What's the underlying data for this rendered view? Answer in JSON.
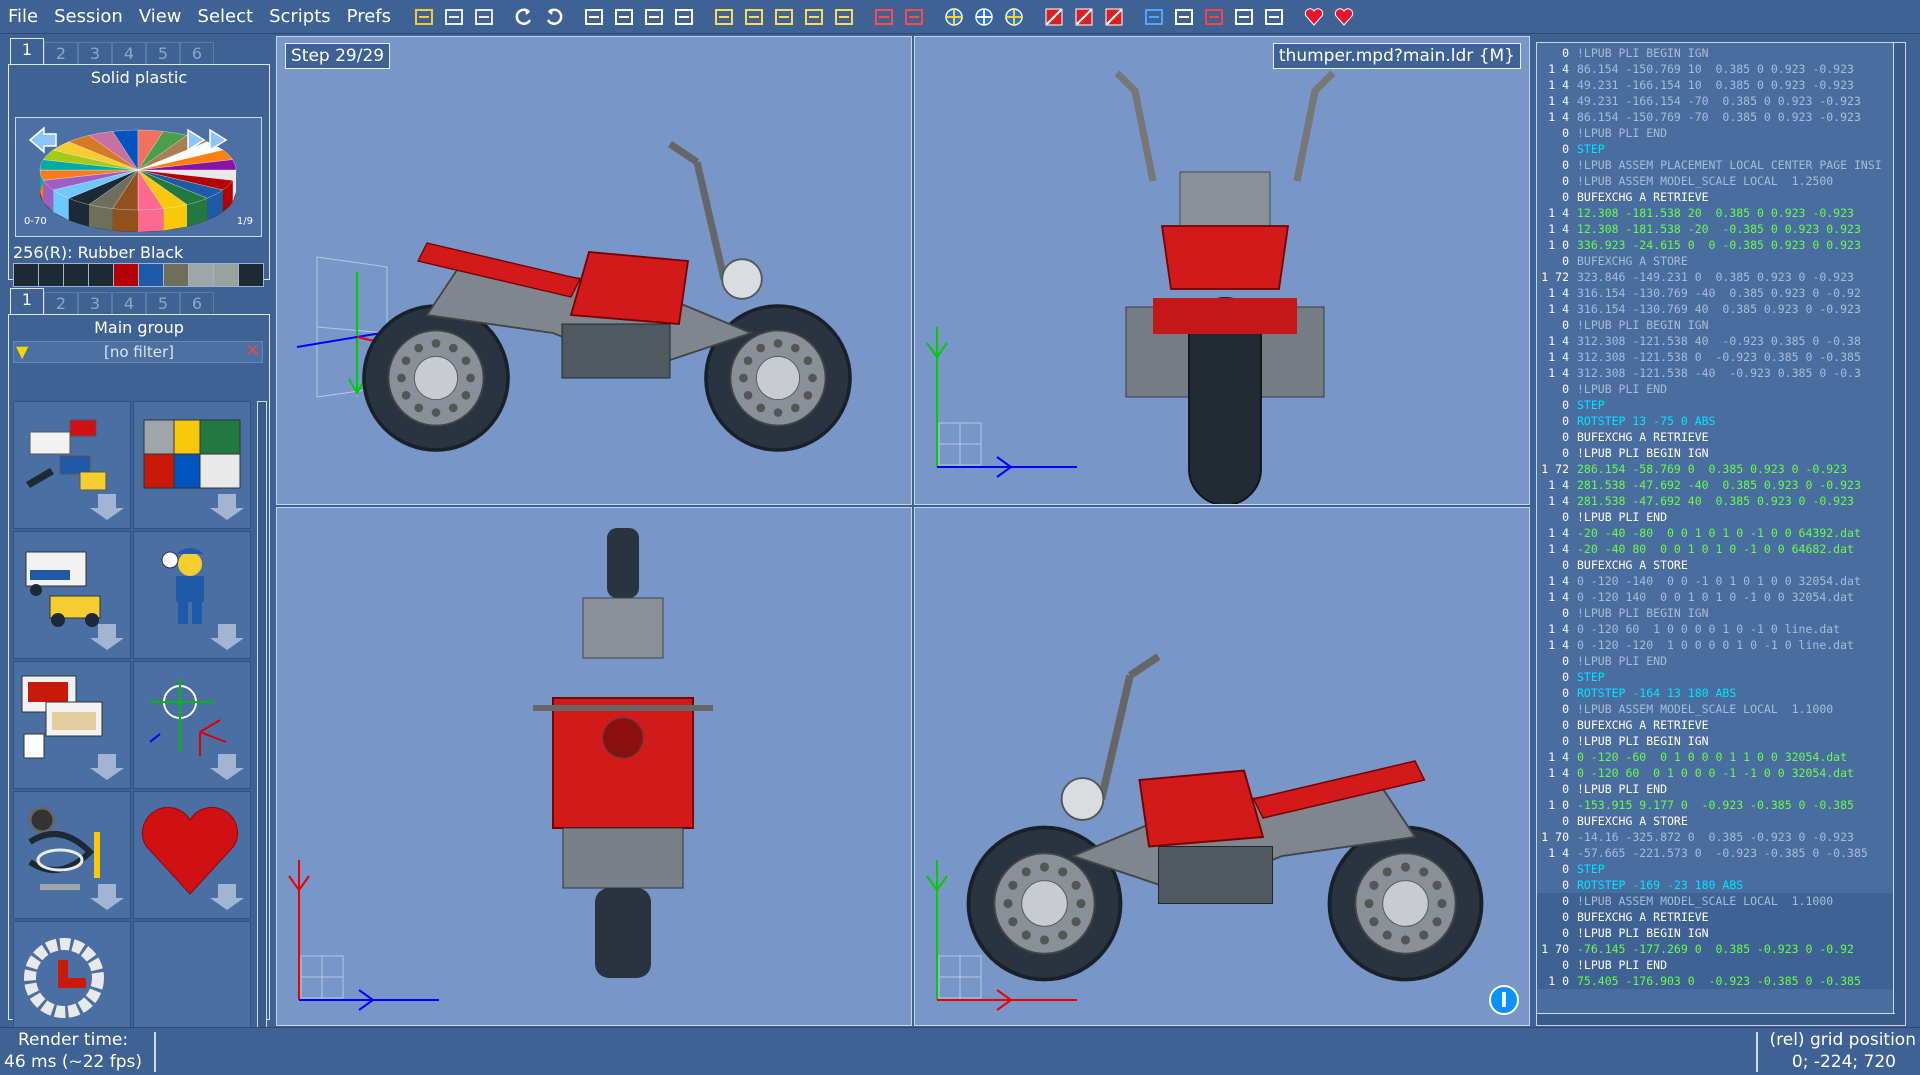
{
  "menu": [
    "File",
    "Session",
    "View",
    "Select",
    "Scripts",
    "Prefs"
  ],
  "toolbar_icons": [
    "open-icon",
    "save-icon",
    "save-as-icon",
    "undo-icon",
    "redo-icon",
    "copy-icon",
    "cut-icon",
    "paste-icon",
    "select-all-icon",
    "first-step-icon",
    "prev-step-icon",
    "next-step-icon",
    "last-step-icon",
    "add-step-icon",
    "insert-part-icon",
    "move-part-icon",
    "color-wheel-icon",
    "crosshair-icon",
    "render-icon",
    "delete-icon",
    "delete-step-icon",
    "clear-icon",
    "grid-icon",
    "move-icon",
    "rotate-icon",
    "pan-icon",
    "snap-icon",
    "favorite-icon",
    "favorite-add-icon"
  ],
  "colors": {
    "bg": "#3e6294",
    "view_bg": "#7896c8",
    "code_bg": "#4a6da0",
    "keyword": "#00e5ff",
    "number": "#67ff45",
    "white": "#ffffff",
    "muted": "#a9bcd6"
  },
  "color_panel": {
    "tabs": [
      "1",
      "2",
      "3",
      "4",
      "5",
      "6"
    ],
    "title": "Solid plastic",
    "range_left": "0-70",
    "range_right": "1/9",
    "selected": "256(R): Rubber Black"
  },
  "swatches": [
    "#1b2a34",
    "#1b2a34",
    "#1b2a34",
    "#1b2a34",
    "#b40000",
    "#1e5aa8",
    "#6d6e5c",
    "#a0a5a9",
    "#9ba19d",
    "#1b2a34"
  ],
  "parts_panel": {
    "tabs": [
      "1",
      "2",
      "3",
      "4",
      "5",
      "6"
    ],
    "title": "Main group",
    "filter": "[no filter]",
    "bins": [
      "bricks-bin-icon",
      "colored-bricks-bin-icon",
      "vehicles-bin-icon",
      "minifig-bin-icon",
      "mpd-bin-icon",
      "axes-bin-icon",
      "cables-bin-icon",
      "heart-bin-icon",
      "ring-bin-icon"
    ]
  },
  "views": {
    "step_label": "Step 29/29",
    "file_label": "thumper.mpd?main.ldr {M}"
  },
  "code_lines": [
    {
      "p": "0",
      "t": "!LPUB PLI BEGIN IGN",
      "c": "muted"
    },
    {
      "p": "1 4",
      "t": "86.154 -150.769 10  0.385 0 0.923 -0.923",
      "c": "muted"
    },
    {
      "p": "1 4",
      "t": "49.231 -166.154 10  0.385 0 0.923 -0.923",
      "c": "muted"
    },
    {
      "p": "1 4",
      "t": "49.231 -166.154 -70  0.385 0 0.923 -0.923",
      "c": "muted"
    },
    {
      "p": "1 4",
      "t": "86.154 -150.769 -70  0.385 0 0.923 -0.923",
      "c": "muted"
    },
    {
      "p": "0",
      "t": "!LPUB PLI END",
      "c": "muted"
    },
    {
      "p": "0",
      "t": "STEP",
      "c": "keyword"
    },
    {
      "p": "0",
      "t": "!LPUB ASSEM PLACEMENT LOCAL CENTER PAGE INSI",
      "c": "muted"
    },
    {
      "p": "0",
      "t": "!LPUB ASSEM MODEL_SCALE LOCAL  1.2500",
      "c": "muted"
    },
    {
      "p": "0",
      "t": "BUFEXCHG A RETRIEVE",
      "c": "white"
    },
    {
      "p": "1 4",
      "t": "12.308 -181.538 20  0.385 0 0.923 -0.923",
      "c": "number"
    },
    {
      "p": "1 4",
      "t": "12.308 -181.538 -20  -0.385 0 0.923 0.923",
      "c": "number"
    },
    {
      "p": "1 0",
      "t": "336.923 -24.615 0  0 -0.385 0.923 0 0.923",
      "c": "number"
    },
    {
      "p": "0",
      "t": "BUFEXCHG A STORE",
      "c": "muted"
    },
    {
      "p": "1 72",
      "t": "323.846 -149.231 0  0.385 0.923 0 -0.923",
      "c": "muted"
    },
    {
      "p": "1 4",
      "t": "316.154 -130.769 -40  0.385 0.923 0 -0.92",
      "c": "muted"
    },
    {
      "p": "1 4",
      "t": "316.154 -130.769 40  0.385 0.923 0 -0.923",
      "c": "muted"
    },
    {
      "p": "0",
      "t": "!LPUB PLI BEGIN IGN",
      "c": "muted"
    },
    {
      "p": "1 4",
      "t": "312.308 -121.538 40  -0.923 0.385 0 -0.38",
      "c": "muted"
    },
    {
      "p": "1 4",
      "t": "312.308 -121.538 0  -0.923 0.385 0 -0.385",
      "c": "muted"
    },
    {
      "p": "1 4",
      "t": "312.308 -121.538 -40  -0.923 0.385 0 -0.3",
      "c": "muted"
    },
    {
      "p": "0",
      "t": "!LPUB PLI END",
      "c": "muted"
    },
    {
      "p": "0",
      "t": "STEP",
      "c": "keyword"
    },
    {
      "p": "0",
      "t": "ROTSTEP 13 -75 0 ABS",
      "c": "keyword"
    },
    {
      "p": "0",
      "t": "BUFEXCHG A RETRIEVE",
      "c": "white"
    },
    {
      "p": "0",
      "t": "!LPUB PLI BEGIN IGN",
      "c": "white"
    },
    {
      "p": "1 72",
      "t": "286.154 -58.769 0  0.385 0.923 0 -0.923",
      "c": "number"
    },
    {
      "p": "1 4",
      "t": "281.538 -47.692 -40  0.385 0.923 0 -0.923",
      "c": "number"
    },
    {
      "p": "1 4",
      "t": "281.538 -47.692 40  0.385 0.923 0 -0.923",
      "c": "number"
    },
    {
      "p": "0",
      "t": "!LPUB PLI END",
      "c": "white"
    },
    {
      "p": "1 4",
      "t": "-20 -40 -80  0 0 1 0 1 0 -1 0 0 64392.dat",
      "c": "number"
    },
    {
      "p": "1 4",
      "t": "-20 -40 80  0 0 1 0 1 0 -1 0 0 64682.dat",
      "c": "number"
    },
    {
      "p": "0",
      "t": "BUFEXCHG A STORE",
      "c": "white"
    },
    {
      "p": "1 4",
      "t": "0 -120 -140  0 0 -1 0 1 0 1 0 0 32054.dat",
      "c": "muted"
    },
    {
      "p": "1 4",
      "t": "0 -120 140  0 0 1 0 1 0 -1 0 0 32054.dat",
      "c": "muted"
    },
    {
      "p": "0",
      "t": "!LPUB PLI BEGIN IGN",
      "c": "muted"
    },
    {
      "p": "1 4",
      "t": "0 -120 60  1 0 0 0 0 1 0 -1 0 line.dat",
      "c": "muted"
    },
    {
      "p": "1 4",
      "t": "0 -120 -120  1 0 0 0 0 1 0 -1 0 line.dat",
      "c": "muted"
    },
    {
      "p": "0",
      "t": "!LPUB PLI END",
      "c": "muted"
    },
    {
      "p": "0",
      "t": "STEP",
      "c": "keyword"
    },
    {
      "p": "0",
      "t": "ROTSTEP -164 13 180 ABS",
      "c": "keyword"
    },
    {
      "p": "0",
      "t": "!LPUB ASSEM MODEL_SCALE LOCAL  1.1000",
      "c": "muted"
    },
    {
      "p": "0",
      "t": "BUFEXCHG A RETRIEVE",
      "c": "white"
    },
    {
      "p": "0",
      "t": "!LPUB PLI BEGIN IGN",
      "c": "white"
    },
    {
      "p": "1 4",
      "t": "0 -120 -60  0 1 0 0 0 1 1 0 0 32054.dat",
      "c": "number"
    },
    {
      "p": "1 4",
      "t": "0 -120 60  0 1 0 0 0 -1 -1 0 0 32054.dat",
      "c": "number"
    },
    {
      "p": "0",
      "t": "!LPUB PLI END",
      "c": "white"
    },
    {
      "p": "1 0",
      "t": "-153.915 9.177 0  -0.923 -0.385 0 -0.385",
      "c": "number"
    },
    {
      "p": "0",
      "t": "BUFEXCHG A STORE",
      "c": "white"
    },
    {
      "p": "1 70",
      "t": "-14.16 -325.872 0  0.385 -0.923 0 -0.923",
      "c": "muted"
    },
    {
      "p": "1 4",
      "t": "-57.665 -221.573 0  -0.923 -0.385 0 -0.385",
      "c": "muted"
    },
    {
      "p": "0",
      "t": "STEP",
      "c": "keyword"
    },
    {
      "p": "0",
      "t": "ROTSTEP -169 -23 180 ABS",
      "c": "keyword"
    },
    {
      "p": "0",
      "t": "!LPUB ASSEM MODEL_SCALE LOCAL  1.1000",
      "c": "muted"
    },
    {
      "p": "0",
      "t": "BUFEXCHG A RETRIEVE",
      "c": "white"
    },
    {
      "p": "0",
      "t": "!LPUB PLI BEGIN IGN",
      "c": "white"
    },
    {
      "p": "1 70",
      "t": "-76.145 -177.269 0  0.385 -0.923 0 -0.92",
      "c": "number"
    },
    {
      "p": "0",
      "t": "!LPUB PLI END",
      "c": "white"
    },
    {
      "p": "1 0",
      "t": "75.405 -176.903 0  -0.923 -0.385 0 -0.385",
      "c": "number"
    }
  ],
  "status": {
    "render_label": "Render time:",
    "render_value": "46 ms (~22 fps)",
    "grid_label": "(rel) grid position",
    "grid_value": "0; -224; 720"
  }
}
